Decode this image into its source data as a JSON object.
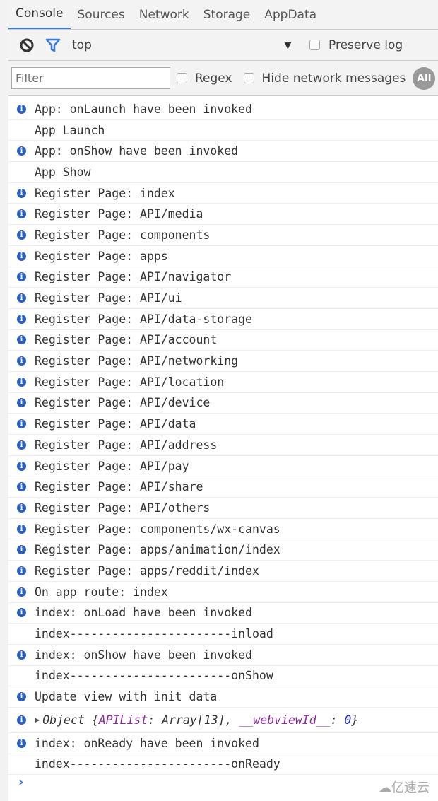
{
  "tabs": [
    "Console",
    "Sources",
    "Network",
    "Storage",
    "AppData"
  ],
  "toolbar": {
    "context": "top",
    "preserve_log": "Preserve log"
  },
  "filterbar": {
    "placeholder": "Filter",
    "regex": "Regex",
    "hide_network": "Hide network messages",
    "all": "All"
  },
  "logs": [
    {
      "info": true,
      "text": "App: onLaunch have been invoked"
    },
    {
      "info": false,
      "text": "App Launch"
    },
    {
      "info": true,
      "text": "App: onShow have been invoked"
    },
    {
      "info": false,
      "text": "App Show"
    },
    {
      "info": true,
      "text": "Register Page: index"
    },
    {
      "info": true,
      "text": "Register Page: API/media"
    },
    {
      "info": true,
      "text": "Register Page: components"
    },
    {
      "info": true,
      "text": "Register Page: apps"
    },
    {
      "info": true,
      "text": "Register Page: API/navigator"
    },
    {
      "info": true,
      "text": "Register Page: API/ui"
    },
    {
      "info": true,
      "text": "Register Page: API/data-storage"
    },
    {
      "info": true,
      "text": "Register Page: API/account"
    },
    {
      "info": true,
      "text": "Register Page: API/networking"
    },
    {
      "info": true,
      "text": "Register Page: API/location"
    },
    {
      "info": true,
      "text": "Register Page: API/device"
    },
    {
      "info": true,
      "text": "Register Page: API/data"
    },
    {
      "info": true,
      "text": "Register Page: API/address"
    },
    {
      "info": true,
      "text": "Register Page: API/pay"
    },
    {
      "info": true,
      "text": "Register Page: API/share"
    },
    {
      "info": true,
      "text": "Register Page: API/others"
    },
    {
      "info": true,
      "text": "Register Page: components/wx-canvas"
    },
    {
      "info": true,
      "text": "Register Page: apps/animation/index"
    },
    {
      "info": true,
      "text": "Register Page: apps/reddit/index"
    },
    {
      "info": true,
      "text": "On app route: index"
    },
    {
      "info": true,
      "text": "index: onLoad have been invoked"
    },
    {
      "info": false,
      "text": "index-----------------------inload"
    },
    {
      "info": true,
      "text": "index: onShow have been invoked"
    },
    {
      "info": false,
      "text": "index-----------------------onShow"
    },
    {
      "info": true,
      "text": "Update view with init data"
    }
  ],
  "object_row": {
    "prefix": "Object {",
    "key1": "APIList",
    "val1": ": Array[13], ",
    "key2": "__webviewId__",
    "sep": ": ",
    "val2": "0",
    "suffix": "}"
  },
  "logs_after": [
    {
      "info": true,
      "text": "index: onReady have been invoked"
    },
    {
      "info": false,
      "text": "index-----------------------onReady"
    }
  ],
  "prompt": "›",
  "watermark": "亿速云",
  "colors": {
    "accent": "#3879d9",
    "info_icon": "#2b5fbd",
    "object_key": "#8a2b9c"
  }
}
